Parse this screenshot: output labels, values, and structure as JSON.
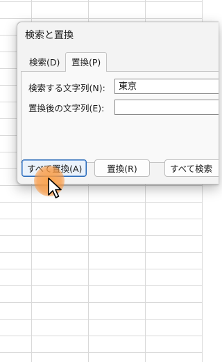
{
  "dialog": {
    "title": "検索と置換",
    "tabs": [
      {
        "label": "検索(D)",
        "underline_char": "D",
        "active": false
      },
      {
        "label": "置換(P)",
        "underline_char": "P",
        "active": true
      }
    ],
    "find_label": "検索する文字列(N):",
    "find_value": "東京",
    "replace_label": "置換後の文字列(E):",
    "replace_value": "",
    "buttons": {
      "replace_all": "すべて置換(A)",
      "replace": "置換(R)",
      "find_all": "すべて検索"
    }
  },
  "colors": {
    "dialog_bg": "#f3f3f3",
    "default_button_border": "#2b6bb8",
    "click_highlight": "#f8a04a"
  }
}
